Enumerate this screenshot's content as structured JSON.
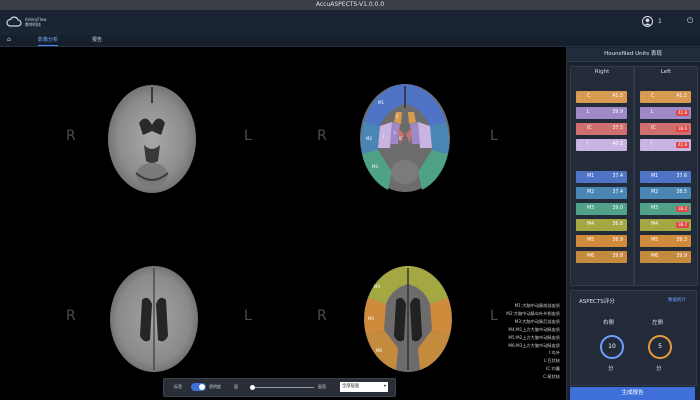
{
  "window": {
    "title": "AccuASPECTS-V1.0.0.0"
  },
  "brand": {
    "name_en": "ArteryFlow",
    "name_cn": "数坤科技"
  },
  "user": {
    "count": "1"
  },
  "nav": {
    "home_icon": "home-icon",
    "tabs": [
      {
        "label": "影像分析",
        "active": true
      },
      {
        "label": "报告",
        "active": false
      }
    ]
  },
  "viewer": {
    "orientation": {
      "right": "R",
      "left": "L"
    },
    "region_labels_top": [
      "C",
      "L",
      "IC",
      "I",
      "M1",
      "M2",
      "M3"
    ],
    "region_labels_bottom": [
      "M4",
      "M5",
      "M6"
    ]
  },
  "legend": [
    "M1:大脑中动脉前部皮质",
    "M2:大脑中动脉岛叶外侧皮质",
    "M3:大脑中动脉后部皮质",
    "M4:M1上方大脑中动脉皮质",
    "M5:M2上方大脑中动脉皮质",
    "M6:M3上方大脑中动脉皮质",
    "I:岛叶",
    "L:豆状核",
    "IC:内囊",
    "C:尾状核"
  ],
  "toolbar": {
    "toggle1_label": "标签",
    "toggle2_label": "透明度",
    "slider_label": "窗",
    "slider2_label": "窗宽",
    "select_value": "全部层面"
  },
  "hu_panel": {
    "title": "Hounsfiled Units 表现",
    "right": {
      "title": "Right",
      "rows": [
        {
          "label": "C",
          "value": "41.5"
        },
        {
          "label": "L",
          "value": "39.9"
        },
        {
          "label": "IC",
          "value": "37.5"
        },
        {
          "label": "I",
          "value": "40.1"
        },
        {
          "label": "M1",
          "value": "37.4"
        },
        {
          "label": "M2",
          "value": "37.4"
        },
        {
          "label": "M3",
          "value": "39.0"
        },
        {
          "label": "M4",
          "value": "36.6"
        },
        {
          "label": "M5",
          "value": "36.9"
        },
        {
          "label": "M6",
          "value": "39.8"
        }
      ]
    },
    "left": {
      "title": "Left",
      "rows": [
        {
          "label": "C",
          "value": "41.1",
          "flag": ""
        },
        {
          "label": "L",
          "value": "",
          "flag": "41.8"
        },
        {
          "label": "IC",
          "value": "",
          "flag": "38.6"
        },
        {
          "label": "I",
          "value": "",
          "flag": "41.8"
        },
        {
          "label": "M1",
          "value": "37.6",
          "flag": ""
        },
        {
          "label": "M2",
          "value": "38.5",
          "flag": ""
        },
        {
          "label": "M3",
          "value": "",
          "flag": "38.2"
        },
        {
          "label": "M4",
          "value": "",
          "flag": "38.7"
        },
        {
          "label": "M5",
          "value": "39.3",
          "flag": ""
        },
        {
          "label": "M6",
          "value": "39.9",
          "flag": ""
        }
      ]
    }
  },
  "aspects": {
    "title": "ASPECTS评分",
    "link": "数据统计",
    "right": {
      "label": "右侧",
      "score": "10",
      "unit": "分"
    },
    "left": {
      "label": "左侧",
      "score": "5",
      "unit": "分"
    }
  },
  "actions": {
    "generate_report": "生成报告"
  },
  "colors": {
    "C": "#d99a52",
    "L": "#9d8ac6",
    "IC": "#cf6f6f",
    "I": "#c9b3e0",
    "M1": "#4f74c6",
    "M2": "#4a86b4",
    "M3": "#4fa287",
    "M4": "#a4a843",
    "M5": "#cf8a3b",
    "M6": "#c48a3e"
  }
}
